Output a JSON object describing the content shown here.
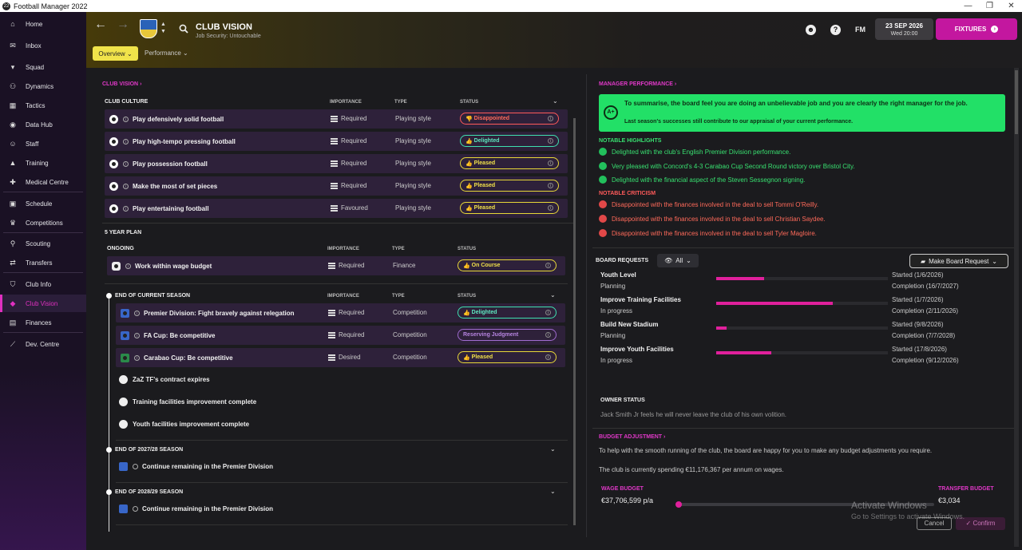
{
  "window": {
    "title": "Football Manager 2022",
    "controls": [
      "—",
      "❐",
      "✕"
    ]
  },
  "sidebar": {
    "items": [
      {
        "label": "Home",
        "icon": "home-icon"
      },
      {
        "label": "Inbox",
        "icon": "inbox-icon"
      },
      {
        "label": "Squad",
        "icon": "shirt-icon"
      },
      {
        "label": "Dynamics",
        "icon": "dynamics-icon"
      },
      {
        "label": "Tactics",
        "icon": "tactics-icon"
      },
      {
        "label": "Data Hub",
        "icon": "data-hub-icon"
      },
      {
        "label": "Staff",
        "icon": "staff-icon"
      },
      {
        "label": "Training",
        "icon": "training-icon"
      },
      {
        "label": "Medical Centre",
        "icon": "medical-icon"
      },
      {
        "label": "Schedule",
        "icon": "calendar-icon"
      },
      {
        "label": "Competitions",
        "icon": "trophy-icon"
      },
      {
        "label": "Scouting",
        "icon": "scouting-icon"
      },
      {
        "label": "Transfers",
        "icon": "transfers-icon"
      },
      {
        "label": "Club Info",
        "icon": "shield-icon"
      },
      {
        "label": "Club Vision",
        "icon": "vision-icon"
      },
      {
        "label": "Finances",
        "icon": "finances-icon"
      },
      {
        "label": "Dev. Centre",
        "icon": "dev-centre-icon"
      }
    ]
  },
  "header": {
    "title": "CLUB VISION",
    "subtitle": "Job Security: Untouchable",
    "fm": "FM",
    "date": "23 SEP 2026",
    "time": "Wed 20:00",
    "fixtures": "FIXTURES",
    "tabs": [
      "Overview",
      "Performance"
    ]
  },
  "vision": {
    "title": "CLUB VISION",
    "culture_title": "CLUB CULTURE",
    "col_importance": "IMPORTANCE",
    "col_type": "TYPE",
    "col_status": "STATUS",
    "culture": [
      {
        "label": "Play defensively solid football",
        "importance": "Required",
        "type": "Playing style",
        "status": "Disappointed"
      },
      {
        "label": "Play high-tempo pressing football",
        "importance": "Required",
        "type": "Playing style",
        "status": "Delighted"
      },
      {
        "label": "Play possession football",
        "importance": "Required",
        "type": "Playing style",
        "status": "Pleased"
      },
      {
        "label": "Make the most of set pieces",
        "importance": "Required",
        "type": "Playing style",
        "status": "Pleased"
      },
      {
        "label": "Play entertaining football",
        "importance": "Favoured",
        "type": "Playing style",
        "status": "Pleased"
      }
    ],
    "plan_title": "5 YEAR PLAN",
    "ongoing_title": "ONGOING",
    "ongoing": [
      {
        "label": "Work within wage budget",
        "importance": "Required",
        "type": "Finance",
        "status": "On Course"
      }
    ],
    "current_title": "END OF CURRENT SEASON",
    "current": [
      {
        "label": "Premier Division: Fight bravely against relegation",
        "importance": "Required",
        "type": "Competition",
        "status": "Delighted"
      },
      {
        "label": "FA Cup: Be competitive",
        "importance": "Required",
        "type": "Competition",
        "status": "Reserving Judgment"
      },
      {
        "label": "Carabao Cup: Be competitive",
        "importance": "Desired",
        "type": "Competition",
        "status": "Pleased"
      }
    ],
    "current_events": [
      "ZaZ TF's contract expires",
      "Training facilities improvement complete",
      "Youth facilities improvement complete"
    ],
    "season2_title": "END OF 2027/28 SEASON",
    "season2_item": "Continue remaining in the Premier Division",
    "season3_title": "END OF 2028/29 SEASON",
    "season3_item": "Continue remaining in the Premier Division"
  },
  "performance": {
    "title": "MANAGER PERFORMANCE",
    "badge": "A+",
    "summary": "To summarise, the board feel you are doing an unbelievable job and you are clearly the right manager for the job.",
    "note": "Last season's successes still contribute to our appraisal of your current performance.",
    "highlights_title": "NOTABLE HIGHLIGHTS",
    "highlights": [
      "Delighted with the club's English Premier Division performance.",
      "Very pleased with Concord's 4-3 Carabao Cup Second Round victory over Bristol City.",
      "Delighted with the financial aspect of the Steven Sessegnon signing."
    ],
    "criticism_title": "NOTABLE CRITICISM",
    "criticism": [
      "Disappointed with the finances involved in the deal to sell Tommi O'Reilly.",
      "Disappointed with the finances involved in the deal to sell Christian Saydee.",
      "Disappointed with the finances involved in the deal to sell Tyler Magloire."
    ]
  },
  "board": {
    "title": "BOARD REQUESTS",
    "filter": "All",
    "make_request": "Make Board Request",
    "requests": [
      {
        "name": "Youth Level",
        "state": "Planning",
        "progress": 0.28,
        "started": "Started (1/6/2026)",
        "completion": "Completion (16/7/2027)"
      },
      {
        "name": "Improve Training Facilities",
        "state": "In progress",
        "progress": 0.68,
        "started": "Started (1/7/2026)",
        "completion": "Completion (2/11/2026)"
      },
      {
        "name": "Build New Stadium",
        "state": "Planning",
        "progress": 0.06,
        "started": "Started (9/8/2026)",
        "completion": "Completion (7/7/2028)"
      },
      {
        "name": "Improve Youth Facilities",
        "state": "In progress",
        "progress": 0.32,
        "started": "Started (17/8/2026)",
        "completion": "Completion (9/12/2026)"
      }
    ],
    "owner_title": "OWNER STATUS",
    "owner_text": "Jack Smith Jr feels he will never leave the club of his own volition."
  },
  "budget": {
    "title": "BUDGET ADJUSTMENT",
    "text1": "To help with the smooth running of the club, the board are happy for you to make any budget adjustments you require.",
    "text2": "The club is currently spending €11,176,367 per annum on wages.",
    "wage_label": "WAGE BUDGET",
    "wage_value": "€37,706,599 p/a",
    "transfer_label": "TRANSFER BUDGET",
    "transfer_value": "€3,034",
    "cancel": "Cancel",
    "confirm": "Confirm"
  },
  "watermark": {
    "line1": "Activate Windows",
    "line2": "Go to Settings to activate Windows."
  },
  "colors": {
    "accent": "#e030c0",
    "highlight": "#22e067",
    "danger": "#ff5a5a"
  }
}
